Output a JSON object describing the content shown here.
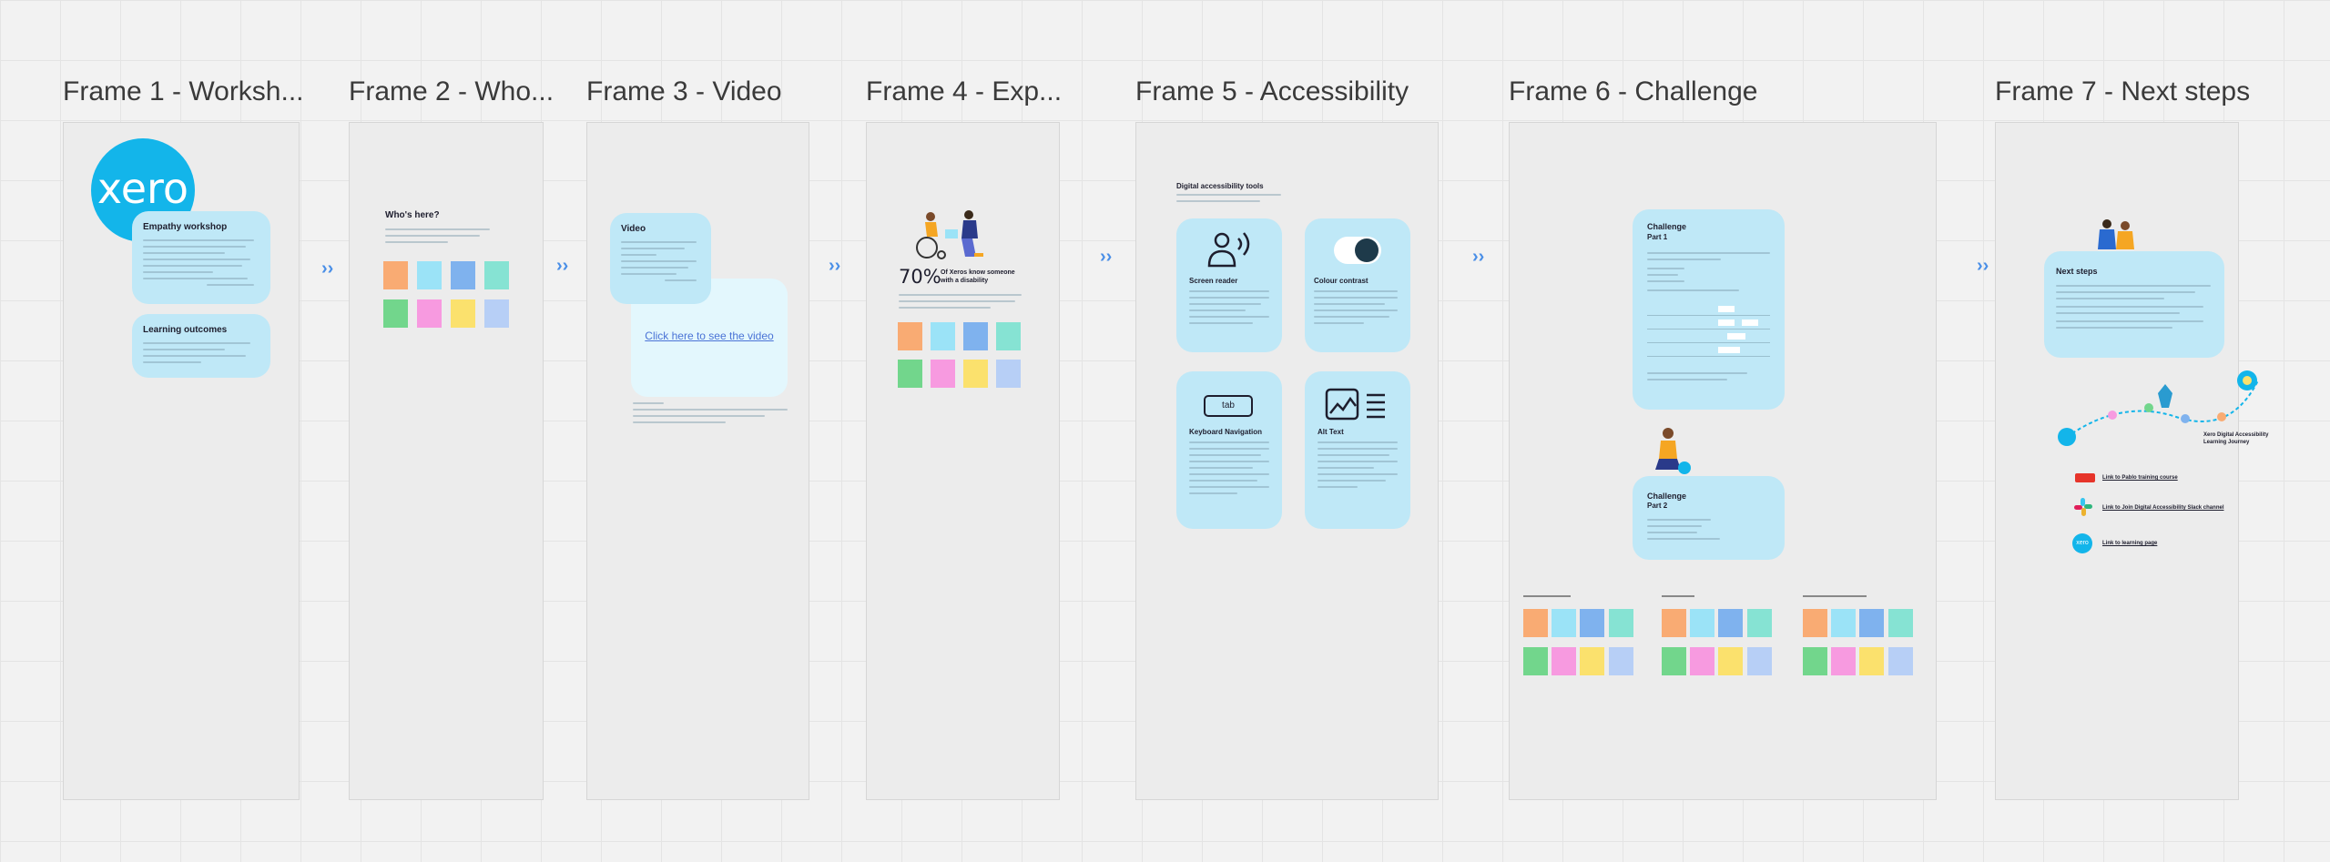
{
  "frames": [
    {
      "title": "Frame 1 - Worksh..."
    },
    {
      "title": "Frame 2 - Who..."
    },
    {
      "title": "Frame 3 - Video"
    },
    {
      "title": "Frame 4 - Exp..."
    },
    {
      "title": "Frame 5 - Accessibility"
    },
    {
      "title": "Frame 6 - Challenge"
    },
    {
      "title": "Frame 7 - Next steps"
    }
  ],
  "frame1": {
    "logo": "xero",
    "empathy_title": "Empathy workshop",
    "outcomes_title": "Learning outcomes"
  },
  "frame2": {
    "title": "Who's here?"
  },
  "frame3": {
    "card_title": "Video",
    "link": "Click here to see the video"
  },
  "frame4": {
    "stat": "70%",
    "stat_label": "Of Xeros know someone with a disability"
  },
  "frame5": {
    "heading": "Digital accessibility tools",
    "cards": [
      {
        "title": "Screen reader"
      },
      {
        "title": "Colour contrast"
      },
      {
        "title": "Keyboard Navigation",
        "key": "tab"
      },
      {
        "title": "Alt Text"
      }
    ]
  },
  "frame6": {
    "challenge1_title": "Challenge",
    "challenge1_part": "Part 1",
    "challenge2_title": "Challenge",
    "challenge2_part": "Part 2"
  },
  "frame7": {
    "next_title": "Next steps",
    "journey_label": "Xero Digital Accessibility Learning Journey",
    "links": [
      "Link to Pablo training course",
      "Link to Join Digital Accessibility Slack channel",
      "Link to learning page"
    ],
    "logo_small": "xero"
  },
  "colors": {
    "card": "#bfe8f7",
    "xero_blue": "#13b5ea",
    "sticky": [
      "#f9ab73",
      "#9be3f7",
      "#7fb2ee",
      "#86e3d3",
      "#72d68c",
      "#f79ae0",
      "#fbe16d",
      "#b7cff6"
    ]
  }
}
